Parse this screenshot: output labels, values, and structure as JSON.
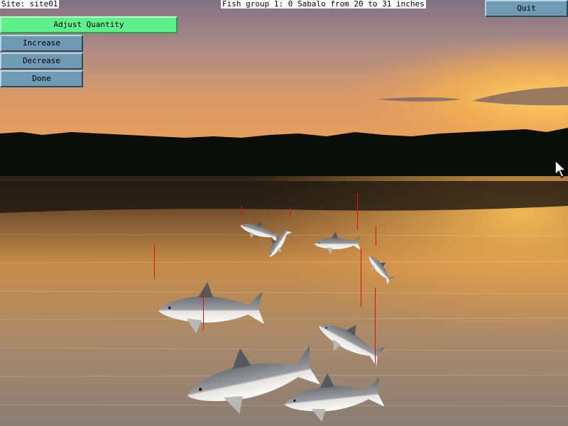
{
  "site_label": "Site: site01",
  "fish_group_label": "Fish group 1: 0 Sabalo from 20 to 31 inches",
  "buttons": {
    "quit": "Quit",
    "adjust_quantity": "Adjust Quantity",
    "increase": "Increase",
    "decrease": "Decrease",
    "done": "Done"
  },
  "colors": {
    "button": "#6e9ab4",
    "button_active": "#5ff08b",
    "fishing_line": "#e01010"
  },
  "icons": [
    "arrow-cursor-icon"
  ]
}
